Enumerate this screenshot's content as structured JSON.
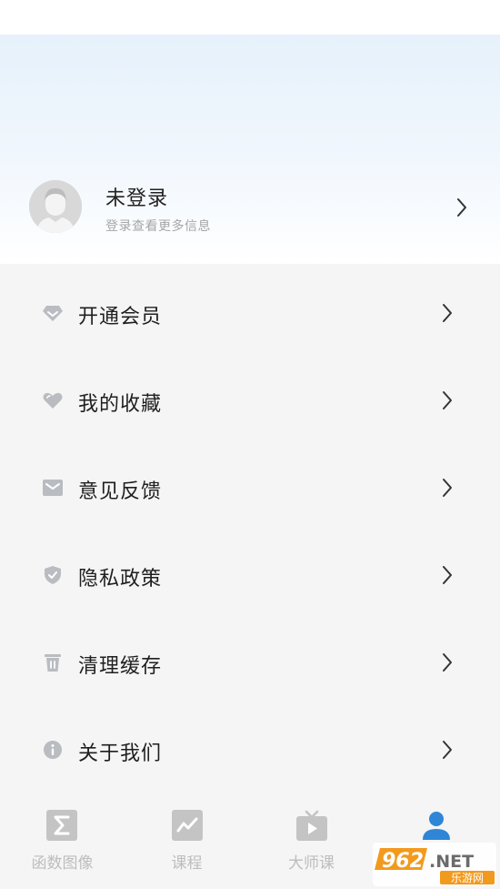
{
  "profile": {
    "name": "未登录",
    "subtitle": "登录查看更多信息"
  },
  "menu": [
    {
      "label": "开通会员",
      "icon": "diamond-icon"
    },
    {
      "label": "我的收藏",
      "icon": "heart-icon"
    },
    {
      "label": "意见反馈",
      "icon": "mail-icon"
    },
    {
      "label": "隐私政策",
      "icon": "shield-icon"
    },
    {
      "label": "清理缓存",
      "icon": "trash-icon"
    },
    {
      "label": "关于我们",
      "icon": "info-icon"
    }
  ],
  "tabs": [
    {
      "label": "函数图像",
      "icon": "sigma-icon",
      "active": false
    },
    {
      "label": "课程",
      "icon": "chart-icon",
      "active": false
    },
    {
      "label": "大师课",
      "icon": "tv-play-icon",
      "active": false
    },
    {
      "label": "",
      "icon": "person-icon",
      "active": true
    }
  ],
  "watermark": {
    "brand": "962.NET",
    "subtitle": "乐游网"
  },
  "colors": {
    "icon_gray": "#b9bcc0",
    "tab_active": "#2f86d6",
    "tab_inactive": "#c4c4c4",
    "text_primary": "#1f1f1f",
    "text_secondary": "#a6a6a6",
    "header_gradient_top": "#e6f1fb",
    "page_bg": "#f5f5f5",
    "watermark_orange": "#f29a1e"
  }
}
